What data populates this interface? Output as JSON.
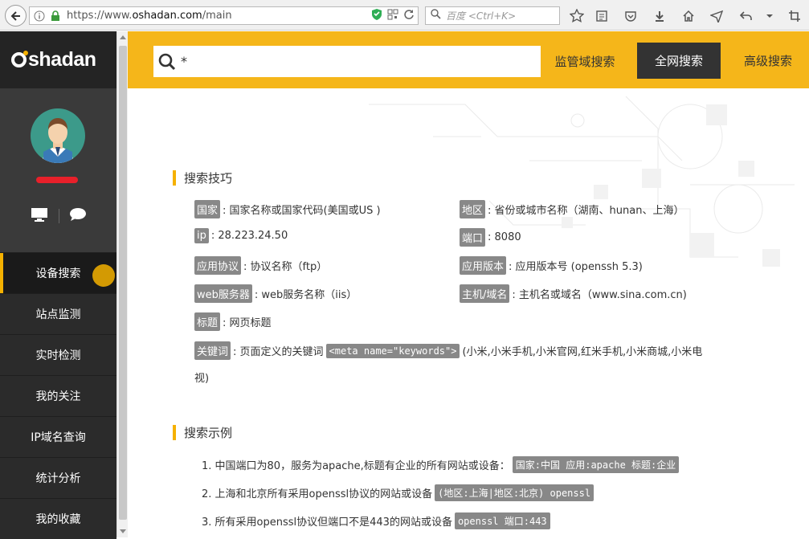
{
  "browser": {
    "url_prefix": "https://www.",
    "url_domain": "oshadan.com",
    "url_path": "/main",
    "search_placeholder": "百度 <Ctrl+K>"
  },
  "logo": {
    "text": "shadan"
  },
  "sidebar": {
    "items": [
      {
        "label": "设备搜索",
        "active": true
      },
      {
        "label": "站点监测",
        "active": false
      },
      {
        "label": "实时检测",
        "active": false
      },
      {
        "label": "我的关注",
        "active": false
      },
      {
        "label": "IP域名查询",
        "active": false
      },
      {
        "label": "统计分析",
        "active": false
      },
      {
        "label": "我的收藏",
        "active": false
      }
    ]
  },
  "search": {
    "query": "*",
    "scope_button": "监管域搜索",
    "all_button": "全网搜索",
    "advanced_button": "高级搜索"
  },
  "tips": {
    "title": "搜索技巧",
    "items": [
      {
        "tag": "国家",
        "desc": ": 国家名称或国家代码(美国或US )"
      },
      {
        "tag": "地区",
        "desc": ": 省份或城市名称（湖南、hunan、上海）"
      },
      {
        "tag": "ip",
        "desc": ": 28.223.24.50"
      },
      {
        "tag": "端口",
        "desc": ": 8080"
      },
      {
        "tag": "应用协议",
        "desc": ": 协议名称（ftp）"
      },
      {
        "tag": "应用版本",
        "desc": ": 应用版本号 (openssh 5.3)"
      },
      {
        "tag": "web服务器",
        "desc": ": web服务名称（iis）"
      },
      {
        "tag": "主机/域名",
        "desc": ": 主机名或域名（www.sina.com.cn)"
      },
      {
        "tag": "标题",
        "desc": ": 网页标题"
      }
    ],
    "keyword": {
      "tag": "关键词",
      "desc": ": 页面定义的关键词",
      "code": "<meta name=\"keywords\">",
      "after": "(小米,小米手机,小米官网,红米手机,小米商城,小米电",
      "after2": "视)"
    }
  },
  "examples": {
    "title": "搜索示例",
    "items": [
      {
        "text": "1. 中国端口为80，服务为apache,标题有企业的所有网站或设备：",
        "code": "国家:中国 应用:apache 标题:企业"
      },
      {
        "text": "2. 上海和北京所有采用openssl协议的网站或设备",
        "code": "(地区:上海|地区:北京) openssl"
      },
      {
        "text": "3. 所有采用openssl协议但端口不是443的网站或设备",
        "code": "openssl 端口:443"
      }
    ]
  },
  "colors": {
    "accent": "#f5b61a",
    "sidebar": "#2b2b2b",
    "tag": "#888888"
  }
}
